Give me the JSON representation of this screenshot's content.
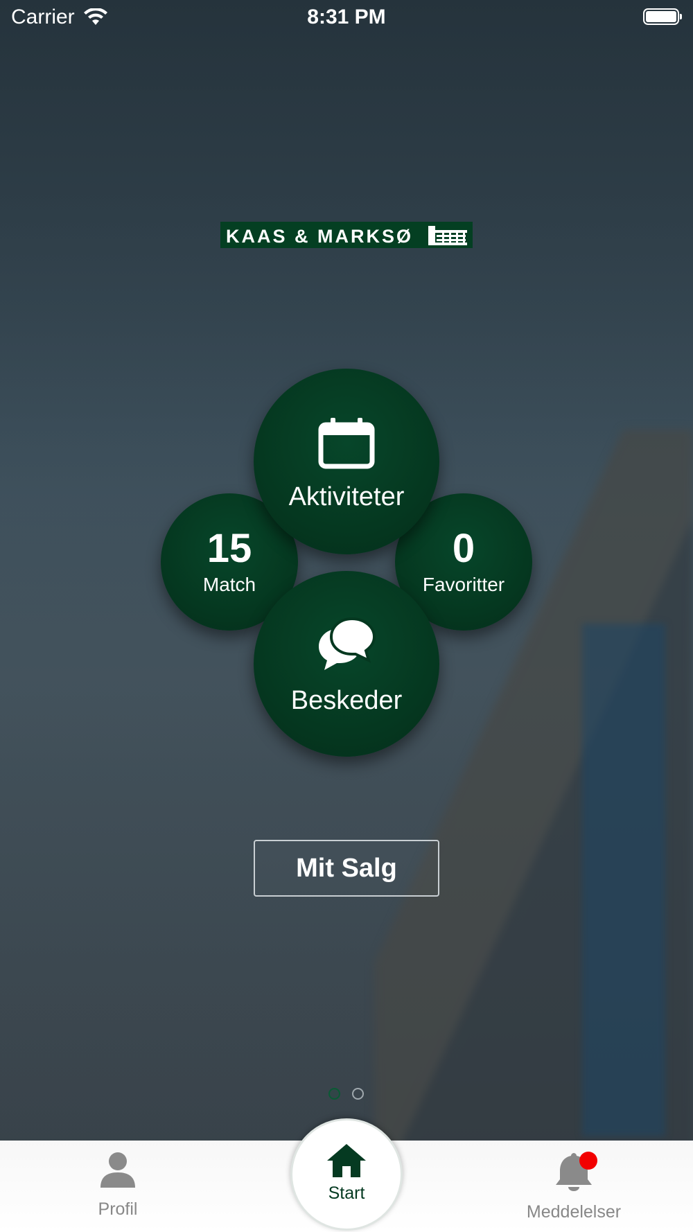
{
  "status_bar": {
    "carrier": "Carrier",
    "time": "8:31 PM"
  },
  "logo": {
    "text": "KAAS & MARKSØ"
  },
  "dashboard": {
    "activities_label": "Aktiviteter",
    "match": {
      "count": "15",
      "label": "Match"
    },
    "favorites": {
      "count": "0",
      "label": "Favoritter"
    },
    "messages_label": "Beskeder"
  },
  "mit_salg_label": "Mit Salg",
  "page_indicator": {
    "current": 1,
    "total": 2
  },
  "tabbar": {
    "profil": "Profil",
    "start": "Start",
    "meddelelser": "Meddelelser",
    "has_unread_badge": true
  },
  "colors": {
    "brand_green": "#053820",
    "badge_red": "#f20000",
    "tab_inactive": "#888888"
  },
  "icons": {
    "activities": "calendar-icon",
    "messages": "chat-bubbles-icon",
    "profil": "person-icon",
    "start": "home-icon",
    "meddelelser": "bell-icon"
  }
}
